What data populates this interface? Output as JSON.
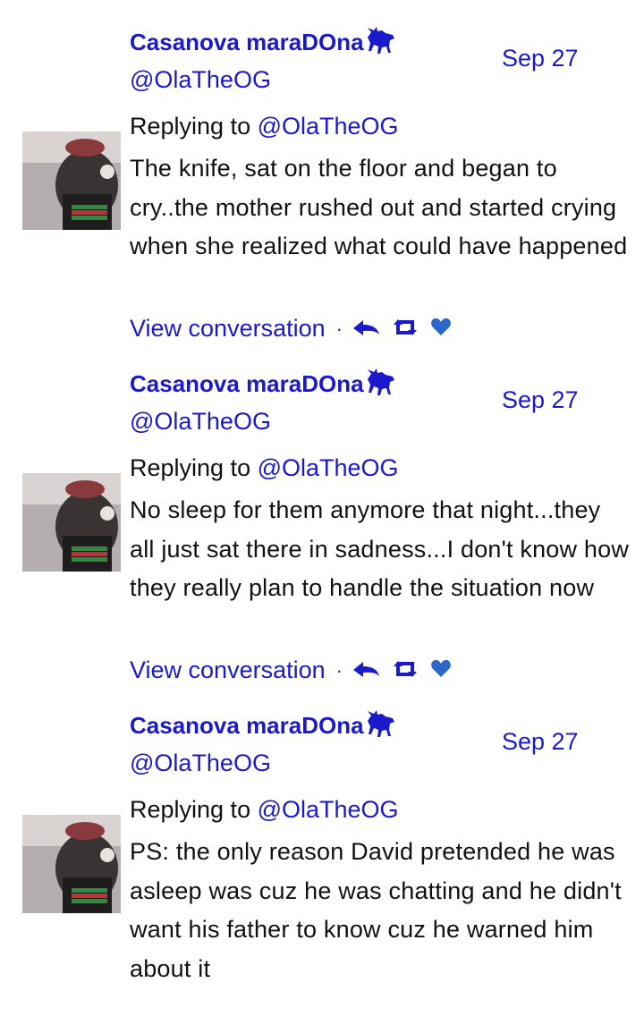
{
  "tweets": [
    {
      "author_name": "Casanova maraDOna",
      "handle": "@OlaTheOG",
      "date": "Sep 27",
      "replying_prefix": "Replying to",
      "replying_to": "@OlaTheOG",
      "text": "The knife, sat on the floor and began to cry..the  mother rushed out and started crying when she realized what could have happened",
      "view_conversation": "View conversation"
    },
    {
      "author_name": "Casanova maraDOna",
      "handle": "@OlaTheOG",
      "date": "Sep 27",
      "replying_prefix": "Replying to",
      "replying_to": "@OlaTheOG",
      "text": "No sleep for them anymore that night...they  all just sat there in sadness...I  don't  know how they really plan to handle the situation now",
      "view_conversation": "View conversation"
    },
    {
      "author_name": "Casanova maraDOna",
      "handle": "@OlaTheOG",
      "date": "Sep 27",
      "replying_prefix": "Replying to",
      "replying_to": "@OlaTheOG",
      "text": "PS: the only reason David pretended he was asleep was cuz he was chatting and he didn't  want his father to know cuz he warned him about it",
      "view_conversation": "View conversation"
    }
  ],
  "colors": {
    "link": "#1a1acc",
    "text": "#111111",
    "background": "#ffffff"
  },
  "icons": [
    "goat-emoji-icon",
    "reply-icon",
    "retweet-icon",
    "like-heart-icon"
  ]
}
